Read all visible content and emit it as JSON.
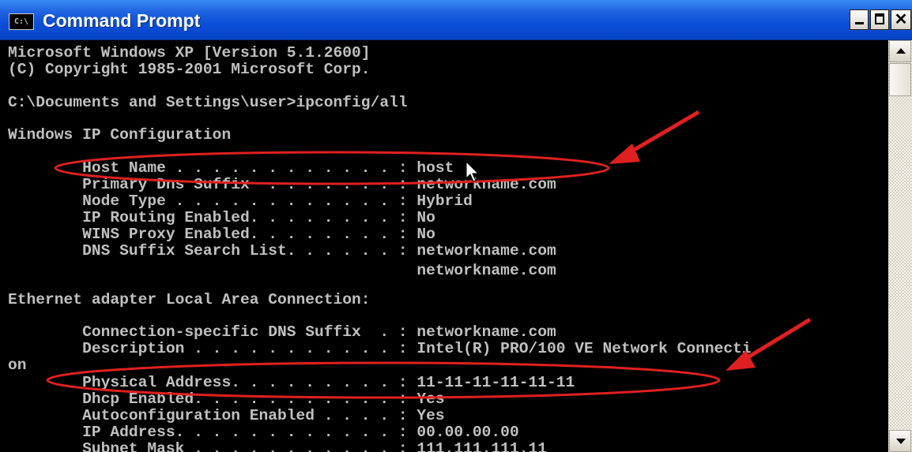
{
  "window": {
    "title": "Command Prompt",
    "icon": "C:\\",
    "close_glyph": "✕"
  },
  "console": {
    "lines": [
      "Microsoft Windows XP [Version 5.1.2600]",
      "(C) Copyright 1985-2001 Microsoft Corp.",
      "C:\\Documents and Settings\\user>ipconfig/all",
      "Windows IP Configuration",
      "        Host Name . . . . . . . . . . . . : host",
      "        Primary Dns Suffix  . . . . . . . : networkname.com",
      "        Node Type . . . . . . . . . . . . : Hybrid",
      "        IP Routing Enabled. . . . . . . . : No",
      "        WINS Proxy Enabled. . . . . . . . : No",
      "        DNS Suffix Search List. . . . . . : networkname.com",
      "                                            networkname.com",
      "Ethernet adapter Local Area Connection:",
      "        Connection-specific DNS Suffix  . : networkname.com",
      "        Description . . . . . . . . . . . : Intel(R) PRO/100 VE Network Connecti",
      "on",
      "        Physical Address. . . . . . . . . : 11-11-11-11-11-11",
      "        Dhcp Enabled. . . . . . . . . . . : Yes",
      "        Autoconfiguration Enabled . . . . : Yes",
      "        IP Address. . . . . . . . . . . . : 00.00.00.00",
      "        Subnet Mask . . . . . . . . . . . : 111.111.111.11"
    ]
  },
  "colors": {
    "console_text": "#c0c0c0",
    "annotation": "#e02020",
    "titlebar": "#0a4fd8"
  },
  "icons": {
    "minimize": "minimize-icon",
    "maximize": "maximize-icon",
    "close": "close-icon",
    "scroll_up": "arrow-up-icon",
    "scroll_down": "arrow-down-icon"
  }
}
